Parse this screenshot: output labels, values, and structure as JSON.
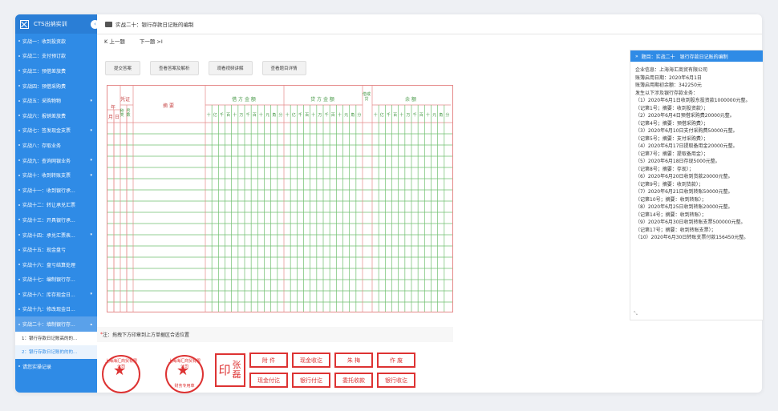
{
  "sidebar": {
    "title": "CTS出纳实训",
    "toggle": "‹",
    "items": [
      {
        "label": "实战一：收到投资款",
        "caret": ""
      },
      {
        "label": "实战二：支付预订款",
        "caret": ""
      },
      {
        "label": "实战三：预借差旅费",
        "caret": ""
      },
      {
        "label": "实战四：预借采购费",
        "caret": ""
      },
      {
        "label": "实战五：采购物物",
        "caret": "▾"
      },
      {
        "label": "实战六：报销差旅费",
        "caret": ""
      },
      {
        "label": "实战七：签发现金支票",
        "caret": "▾"
      },
      {
        "label": "实战八：存取业务",
        "caret": ""
      },
      {
        "label": "实战九：查询网银业务",
        "caret": "▾"
      },
      {
        "label": "实战十：收到转账支票",
        "caret": "▾"
      },
      {
        "label": "实战十一：收到银行承...",
        "caret": ""
      },
      {
        "label": "实战十二：转让承兑汇票",
        "caret": ""
      },
      {
        "label": "实战十三：开具银行承...",
        "caret": ""
      },
      {
        "label": "实战十四：承兑汇票表...",
        "caret": "▾"
      },
      {
        "label": "实战十五：现金盘亏",
        "caret": ""
      },
      {
        "label": "实战十六：盘亏结算处理",
        "caret": ""
      },
      {
        "label": "实战十七：编制银行存...",
        "caret": ""
      },
      {
        "label": "实战十八：库存现金日...",
        "caret": "▾"
      },
      {
        "label": "实战十九：修改现金日...",
        "caret": ""
      },
      {
        "label": "实战二十：填制银行存...",
        "caret": "▴"
      }
    ],
    "subitems": [
      {
        "label": "1：银行存款日记账高的的..."
      },
      {
        "label": "2：银行存款日记账的的的..."
      }
    ],
    "last_item": "请您实操记录"
  },
  "topbar": {
    "title": "实战二十：银行存款日记账的编制"
  },
  "nav": {
    "prev": "K 上一题",
    "next": "下一题 >I"
  },
  "buttons": [
    "提交答案",
    "查看答案及解析",
    "观看视频讲解",
    "查看题目详情"
  ],
  "ledger": {
    "year": "年",
    "month": "月",
    "day": "日",
    "voucher": "凭证",
    "voucher_type": "种类",
    "voucher_no": "号数",
    "summary": "摘 要",
    "debit": "借 方 金 额",
    "credit": "贷 方 金 额",
    "direction": "借或贷",
    "balance": "余 额",
    "digits": [
      "十",
      "亿",
      "千",
      "百",
      "十",
      "万",
      "千",
      "百",
      "十",
      "元",
      "角",
      "分"
    ]
  },
  "note": {
    "star": "*",
    "text": "注：拖拽下方印章到上方单据区合适位置"
  },
  "stamps": {
    "seal1_ring": "上海海汇商贸有限公司",
    "seal1_star": "★",
    "seal2_ring": "上海海汇商贸有限公司",
    "seal2_star": "★",
    "seal2_bottom": "财务专用章",
    "zhang_yin": "印",
    "zhang_name": "张磊",
    "labels": [
      "附 件",
      "现金收讫",
      "朱 梅",
      "作 废",
      "现金付讫",
      "银行付讫",
      "委托收款",
      "银行收讫"
    ]
  },
  "panel": {
    "header": "题目：实战二十　银行存款日记账的编制",
    "lines": [
      "企业信息：上海海汇商贸有限公司",
      "账簿启用日期：2020年6月1日",
      "账簿启用期初余额：342250元",
      "发生以下涉及银行存款业务：",
      "（1）2020年6月1日收到股东投资款1000000元整。",
      "（记第1号；摘要：收到投资款）；",
      "（2）2020年6月4日预借采购费20000元整。",
      "（记第4号；摘要：预借采购费）；",
      "（3）2020年6月10日支付采购费50000元整。",
      "（记第5号；摘要：支付采购费）；",
      "（4）2020年6月17日提取备用金20000元整。",
      "（记第7号；摘要：提取备用金）；",
      "（5）2020年6月18日存现5000元整。",
      "（记第8号；摘要：存现）；",
      "（6）2020年6月20日收到货款20000元整。",
      "（记第9号；摘要：收到货款）；",
      "（7）2020年6月21日收到转账50000元整。",
      "（记第10号；摘要：收到转账）；",
      "（8）2020年6月25日收到转账20000元整。",
      "（记第14号；摘要：收到转账）；",
      "（9）2020年6月30日收到转账支票500000元整。",
      "（记第17号；摘要：收到转账支票）；",
      "（10）2020年6月30日转账支票付款156450元整。"
    ]
  },
  "colors": {
    "accent": "#2f8be6",
    "ledger_red": "#e58a8a",
    "ledger_green": "#6fbf6f",
    "stamp_red": "#d33333"
  }
}
